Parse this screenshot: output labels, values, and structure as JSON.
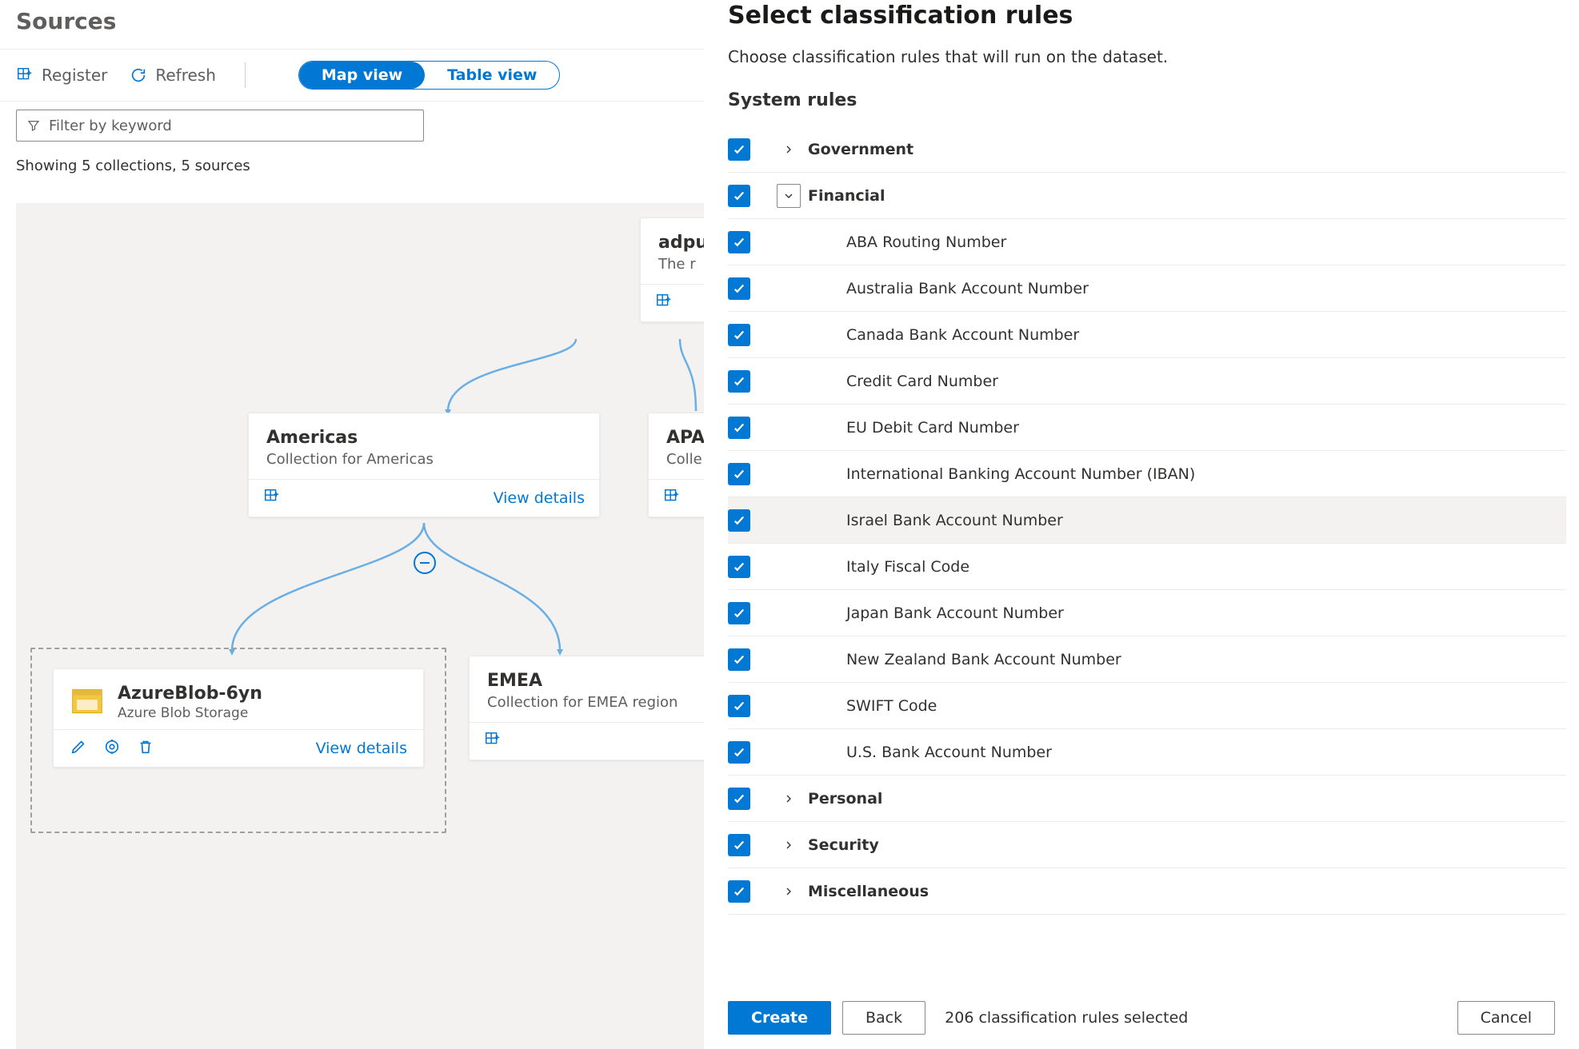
{
  "page": {
    "title": "Sources",
    "showing": "Showing 5 collections, 5 sources"
  },
  "toolbar": {
    "register": "Register",
    "refresh": "Refresh",
    "map_view": "Map view",
    "table_view": "Table view"
  },
  "filter": {
    "placeholder": "Filter by keyword"
  },
  "cards": {
    "root": {
      "title": "adpu",
      "sub": "The r"
    },
    "americas": {
      "title": "Americas",
      "sub": "Collection for Americas",
      "details": "View details"
    },
    "apac": {
      "title": "APA",
      "sub": "Colle"
    },
    "emea": {
      "title": "EMEA",
      "sub": "Collection for EMEA region"
    },
    "azureblob": {
      "title": "AzureBlob-6yn",
      "sub": "Azure Blob Storage",
      "details": "View details"
    }
  },
  "panel": {
    "title": "Select classification rules",
    "desc": "Choose classification rules that will run on the dataset.",
    "section": "System rules",
    "groups": {
      "government": {
        "label": "Government",
        "expanded": false
      },
      "financial": {
        "label": "Financial",
        "expanded": true,
        "children": [
          "ABA Routing Number",
          "Australia Bank Account Number",
          "Canada Bank Account Number",
          "Credit Card Number",
          "EU Debit Card Number",
          "International Banking Account Number (IBAN)",
          "Israel Bank Account Number",
          "Italy Fiscal Code",
          "Japan Bank Account Number",
          "New Zealand Bank Account Number",
          "SWIFT Code",
          "U.S. Bank Account Number"
        ],
        "highlight_index": 6
      },
      "personal": {
        "label": "Personal",
        "expanded": false
      },
      "security": {
        "label": "Security",
        "expanded": false
      },
      "misc": {
        "label": "Miscellaneous",
        "expanded": false
      }
    },
    "footer": {
      "create": "Create",
      "back": "Back",
      "cancel": "Cancel",
      "selected": "206 classification rules selected"
    }
  },
  "colors": {
    "accent": "#0078d4"
  }
}
